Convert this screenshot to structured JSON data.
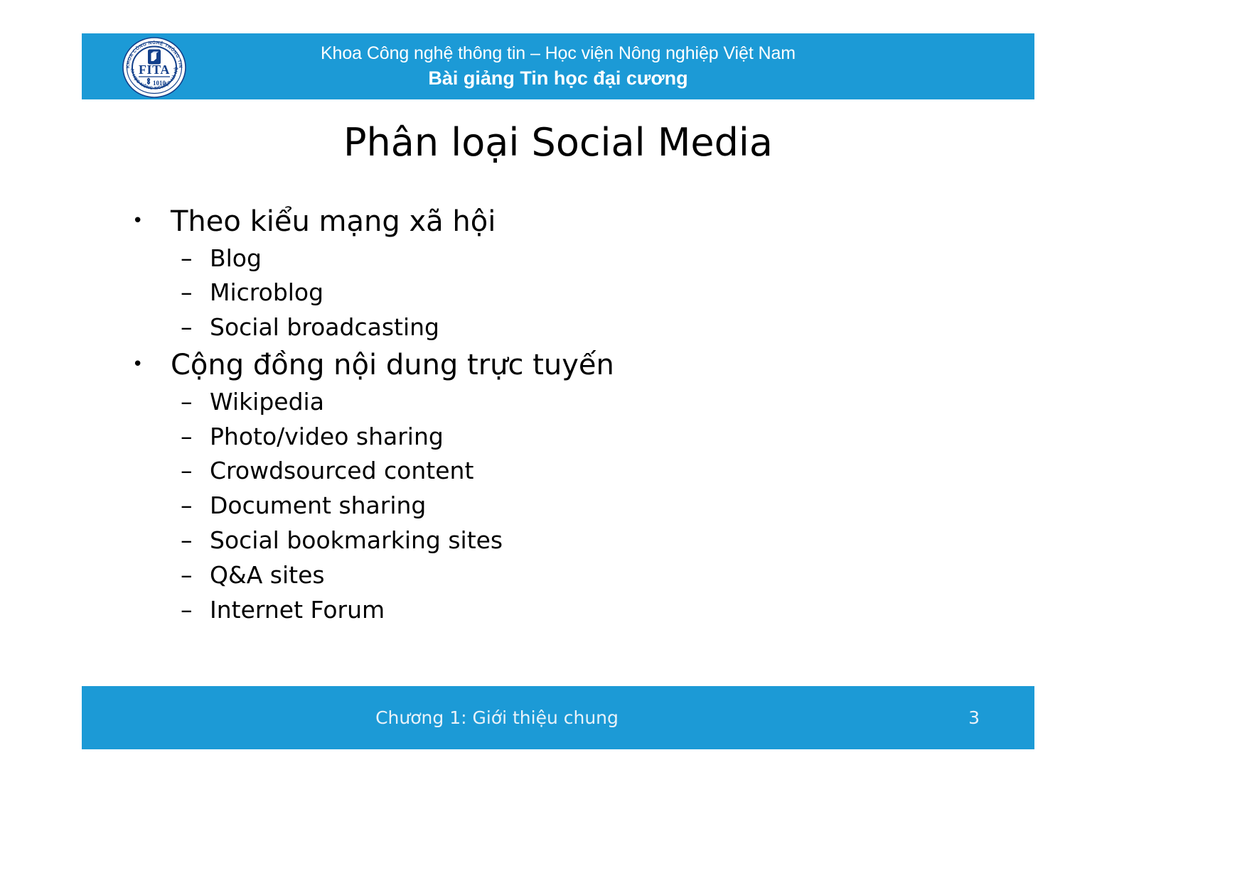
{
  "slide": {
    "accent_color": "#1C9AD6",
    "text_color": "#000000",
    "header": {
      "line1": "Khoa Công nghệ thông tin – Học viện Nông nghiệp Việt Nam",
      "line2": "Bài giảng Tin học đại cương",
      "logo": {
        "name": "fita-logo",
        "acronym": "FITA",
        "year": "1010",
        "ring_text_top": "KHOA CÔNG NGHỆ THÔNG TIN",
        "ring_text_bottom": "ĐẠI HỌC NÔNG NGHIỆP HÀ NỘI"
      }
    },
    "title": "Phân loại Social Media",
    "content": [
      {
        "level1": "Theo kiểu mạng xã hội",
        "items": [
          "Blog",
          "Microblog",
          "Social broadcasting"
        ]
      },
      {
        "level1": "Cộng đồng nội dung trực tuyến",
        "items": [
          "Wikipedia",
          "Photo/video sharing",
          "Crowdsourced content",
          "Document sharing",
          "Social bookmarking sites",
          "Q&A sites",
          "Internet Forum"
        ]
      }
    ],
    "markers": {
      "bullet": "•",
      "dash": "–"
    },
    "footer": {
      "text": "Chương 1: Giới thiệu chung",
      "page_number": "3"
    }
  }
}
